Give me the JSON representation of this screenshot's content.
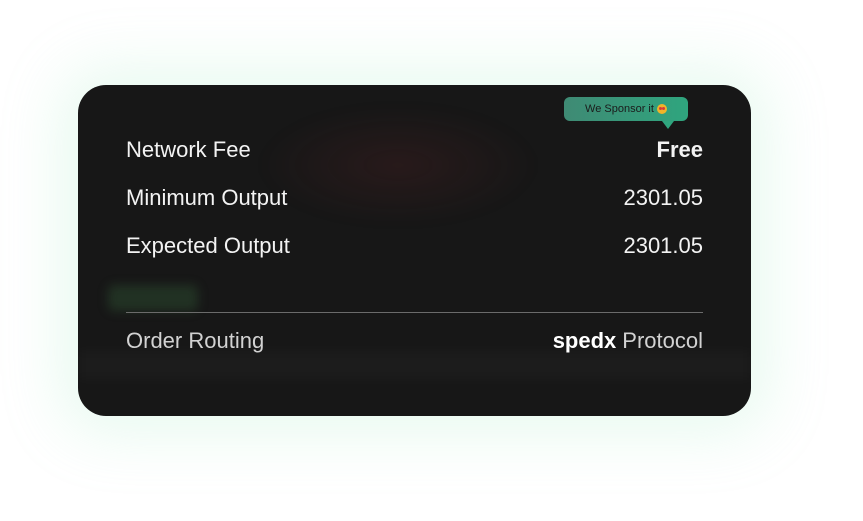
{
  "rows": {
    "network_fee": {
      "label": "Network Fee",
      "value": "Free"
    },
    "minimum_output": {
      "label": "Minimum Output",
      "value": "2301.05"
    },
    "expected_output": {
      "label": "Expected Output",
      "value": "2301.05"
    }
  },
  "routing": {
    "label": "Order Routing",
    "brand": "spedx",
    "protocol": "Protocol"
  },
  "tooltip": {
    "text": "We Sponsor it",
    "icon": "heart-eyes-emoji-icon"
  },
  "colors": {
    "card_background": "#171717",
    "tooltip_accent": "#2fa57e",
    "card_glow": "#96e6b9"
  }
}
